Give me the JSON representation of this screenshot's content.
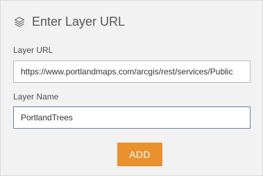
{
  "dialog": {
    "title": "Enter Layer URL",
    "icon": "layers-icon"
  },
  "layer_url": {
    "label": "Layer URL",
    "value": "https://www.portlandmaps.com/arcgis/rest/services/Public"
  },
  "layer_name": {
    "label": "Layer Name",
    "value": "PortlandTrees"
  },
  "add_button": {
    "label": "ADD",
    "color": "#e8912e"
  }
}
